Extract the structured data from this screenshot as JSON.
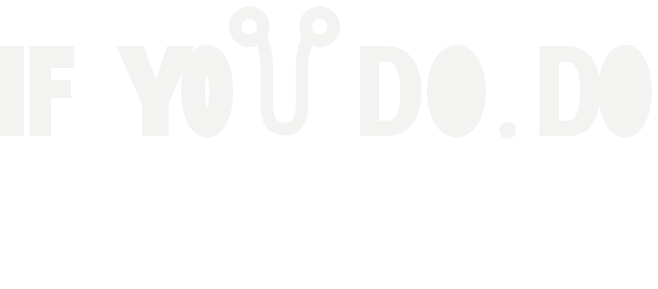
{
  "logo": {
    "wordmark": "IF YOU DO.DO",
    "fill_color": "#f3f3f2",
    "background_color": "#ffffff"
  }
}
